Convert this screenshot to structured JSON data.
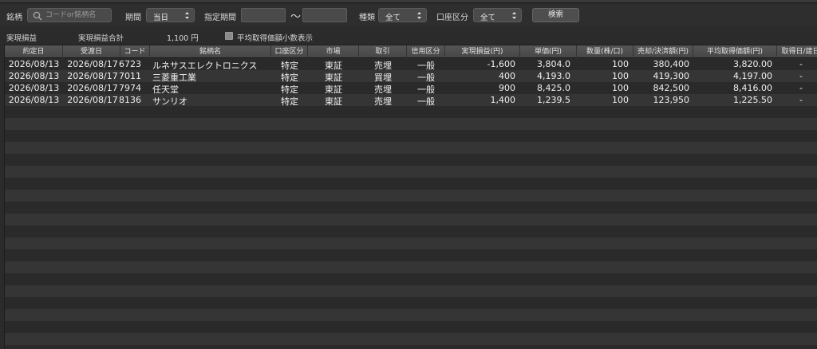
{
  "filters": {
    "symbol_label": "銘柄",
    "search_placeholder": "コードor銘柄名",
    "period_label": "期間",
    "period_value": "当日",
    "range_label": "指定期間",
    "range_separator": "〜",
    "kind_label": "種類",
    "kind_value": "全て",
    "account_label": "口座区分",
    "account_value": "全て",
    "search_button": "検索"
  },
  "summary": {
    "section_label": "実現損益",
    "total_label": "実現損益合計",
    "total_value": "1,100 円",
    "checkbox_label": "平均取得価額小数表示"
  },
  "table": {
    "columns": [
      "約定日",
      "受渡日",
      "コード",
      "銘柄名",
      "口座区分",
      "市場",
      "取引",
      "信用区分",
      "実現損益(円)",
      "単価(円)",
      "数量(株/口)",
      "売却/決済額(円)",
      "平均取得価額(円)",
      "取得日/建日"
    ],
    "rows": [
      [
        "2026/08/13",
        "2026/08/17",
        "6723",
        "ルネサスエレクトロニクス",
        "特定",
        "東証",
        "売埋",
        "一般",
        "-1,600",
        "3,804.0",
        "100",
        "380,400",
        "3,820.00",
        "-"
      ],
      [
        "2026/08/13",
        "2026/08/17",
        "7011",
        "三菱重工業",
        "特定",
        "東証",
        "買埋",
        "一般",
        "400",
        "4,193.0",
        "100",
        "419,300",
        "4,197.00",
        "-"
      ],
      [
        "2026/08/13",
        "2026/08/17",
        "7974",
        "任天堂",
        "特定",
        "東証",
        "売埋",
        "一般",
        "900",
        "8,425.0",
        "100",
        "842,500",
        "8,416.00",
        "-"
      ],
      [
        "2026/08/13",
        "2026/08/17",
        "8136",
        "サンリオ",
        "特定",
        "東証",
        "売埋",
        "一般",
        "1,400",
        "1,239.5",
        "100",
        "123,950",
        "1,225.50",
        "-"
      ]
    ]
  }
}
